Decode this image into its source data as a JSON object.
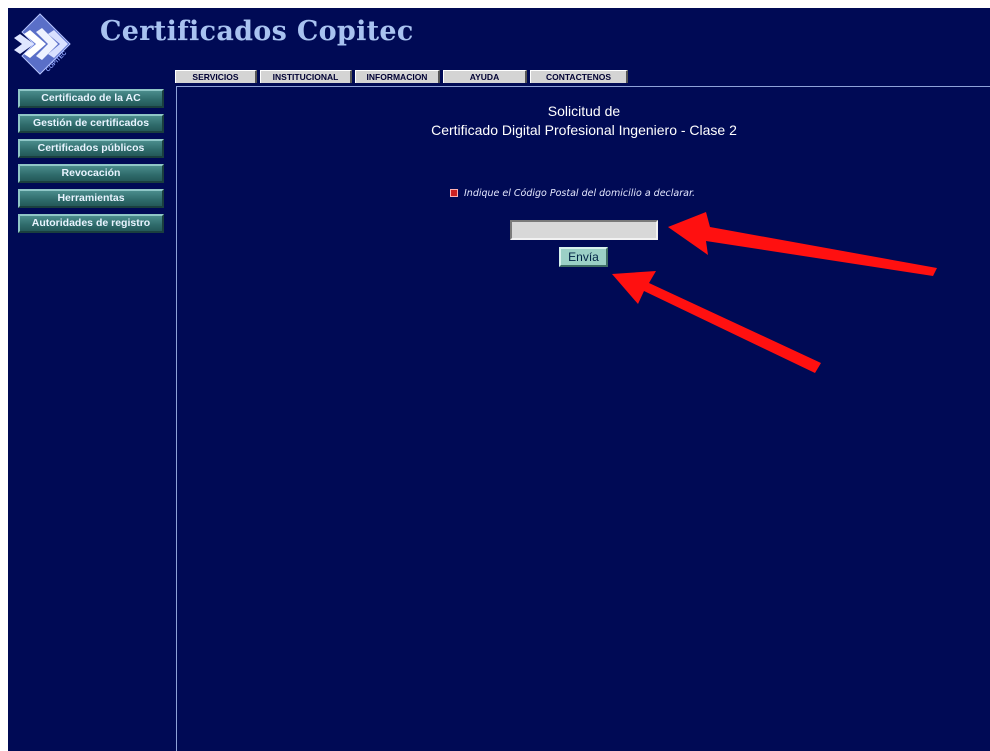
{
  "site": {
    "title": "Certificados Copitec",
    "logo_text": "COPITEC"
  },
  "topnav": {
    "items": [
      {
        "label": "SERVICIOS"
      },
      {
        "label": "INSTITUCIONAL"
      },
      {
        "label": "INFORMACION"
      },
      {
        "label": "AYUDA"
      },
      {
        "label": "CONTACTENOS"
      }
    ]
  },
  "sidebar": {
    "items": [
      {
        "label": "Certificado de la AC"
      },
      {
        "label": "Gestión de certificados"
      },
      {
        "label": "Certificados públicos"
      },
      {
        "label": "Revocación"
      },
      {
        "label": "Herramientas"
      },
      {
        "label": "Autoridades de registro"
      }
    ]
  },
  "main": {
    "heading_line1": "Solicitud de",
    "heading_line2": "Certificado Digital Profesional Ingeniero - Clase 2",
    "instruction": "Indique el Código Postal del domicilio a declarar.",
    "postal_code_value": "",
    "submit_label": "Envía"
  },
  "colors": {
    "background": "#000a55",
    "sidebar_button": "#2e6a6a",
    "submit_button": "#9bd0c6",
    "annotation_arrow": "#ff1010"
  },
  "icons": {
    "logo": "copitec-chevrons-logo",
    "bullet": "red-square-bullet",
    "annotations": "red-arrow"
  }
}
